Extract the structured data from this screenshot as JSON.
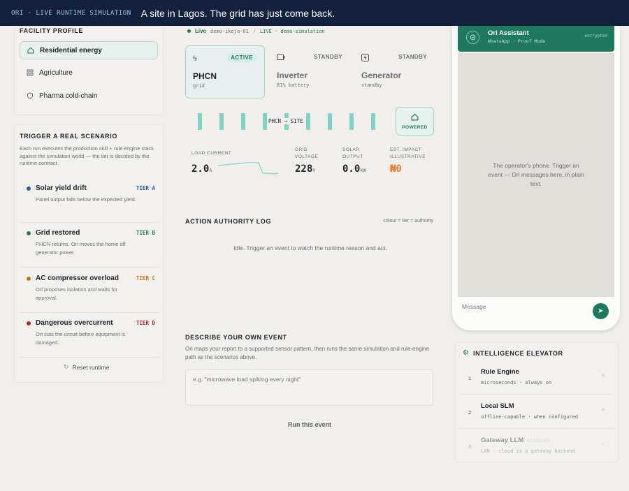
{
  "topbar": {
    "tag": "ORI · LIVE RUNTIME SIMULATION",
    "title": "A site in Lagos. The grid has just come back."
  },
  "facility": {
    "heading": "FACILITY PROFILE",
    "items": [
      {
        "label": "Residential energy",
        "icon": "home-icon",
        "selected": true
      },
      {
        "label": "Agriculture",
        "icon": "grid-icon",
        "selected": false
      },
      {
        "label": "Pharma cold-chain",
        "icon": "shield-icon",
        "selected": false
      }
    ]
  },
  "trigger": {
    "heading": "TRIGGER A REAL SCENARIO",
    "description": "Each run executes the production skill + rule-engine stack against the simulation world — the tier is decided by the runtime contract.",
    "scenarios": [
      {
        "name": "Solar yield drift",
        "tier": "TIER A",
        "desc": "Panel output falls below the expected yield.",
        "color": "#1f5fae"
      },
      {
        "name": "Grid restored",
        "tier": "TIER B",
        "desc": "PHCN returns. Ori moves the home off generator power.",
        "color": "#1f7a5e"
      },
      {
        "name": "AC compressor overload",
        "tier": "TIER C",
        "desc": "Ori proposes isolation and waits for approval.",
        "color": "#c47a12"
      },
      {
        "name": "Dangerous overcurrent",
        "tier": "TIER D",
        "desc": "Ori cuts the circuit before equipment is damaged.",
        "color": "#b3261e"
      }
    ],
    "reset_label": "Reset runtime"
  },
  "status": {
    "live": "Live",
    "site": "demo-ikeja-01",
    "sep": "/",
    "mode": "LIVE · demo-simulation"
  },
  "sources": [
    {
      "name": "PHCN",
      "sub": "grid",
      "state": "ACTIVE",
      "icon": "bolt-icon",
      "selected": true
    },
    {
      "name": "Inverter",
      "sub": "81% battery",
      "state": "STANDBY",
      "icon": "battery-icon",
      "selected": false
    },
    {
      "name": "Generator",
      "sub": "standby",
      "state": "STANDBY",
      "icon": "generator-icon",
      "selected": false
    }
  ],
  "flow": {
    "label": "PHCN → SITE",
    "powered": "POWERED"
  },
  "metrics": {
    "load": {
      "label": "LOAD CURRENT",
      "value": "2.0",
      "unit": "A"
    },
    "voltage": {
      "label1": "GRID",
      "label2": "VOLTAGE",
      "value": "228",
      "unit": "V"
    },
    "solar": {
      "label1": "SOLAR",
      "label2": "OUTPUT",
      "value": "0.0",
      "unit": "kW"
    },
    "impact": {
      "label1": "EST. IMPACT",
      "label2": "ILLUSTRATIVE",
      "value": "₦0"
    }
  },
  "log": {
    "heading": "ACTION AUTHORITY LOG",
    "legend": "colour = tier = authority",
    "idle": "Idle. Trigger an event to watch the runtime reason and act."
  },
  "event": {
    "heading": "DESCRIBE YOUR OWN EVENT",
    "description": "Ori maps your report to a supported sensor pattern, then runs the same simulation and rule-engine path as the scenarios above.",
    "placeholder": "e.g. \"microwave load spiking every night\"",
    "run_label": "Run this event"
  },
  "phone": {
    "name": "Ori Assistant",
    "sub": "WhatsApp · Proof Mode",
    "encrypted": "encrypted",
    "empty": "The operator's phone. Trigger an event — Ori messages here, in plain text.",
    "placeholder": "Message"
  },
  "elevator": {
    "heading": "INTELLIGENCE ELEVATOR",
    "levels": [
      {
        "num": "1",
        "name": "Rule Engine",
        "sub": "microseconds · always on",
        "reserved": ""
      },
      {
        "num": "2",
        "name": "Local SLM",
        "sub": "offline-capable · when configured",
        "reserved": ""
      },
      {
        "num": "3",
        "name": "Gateway LLM",
        "sub": "LAN · cloud is a gateway backend",
        "reserved": "RESERVED"
      }
    ]
  }
}
